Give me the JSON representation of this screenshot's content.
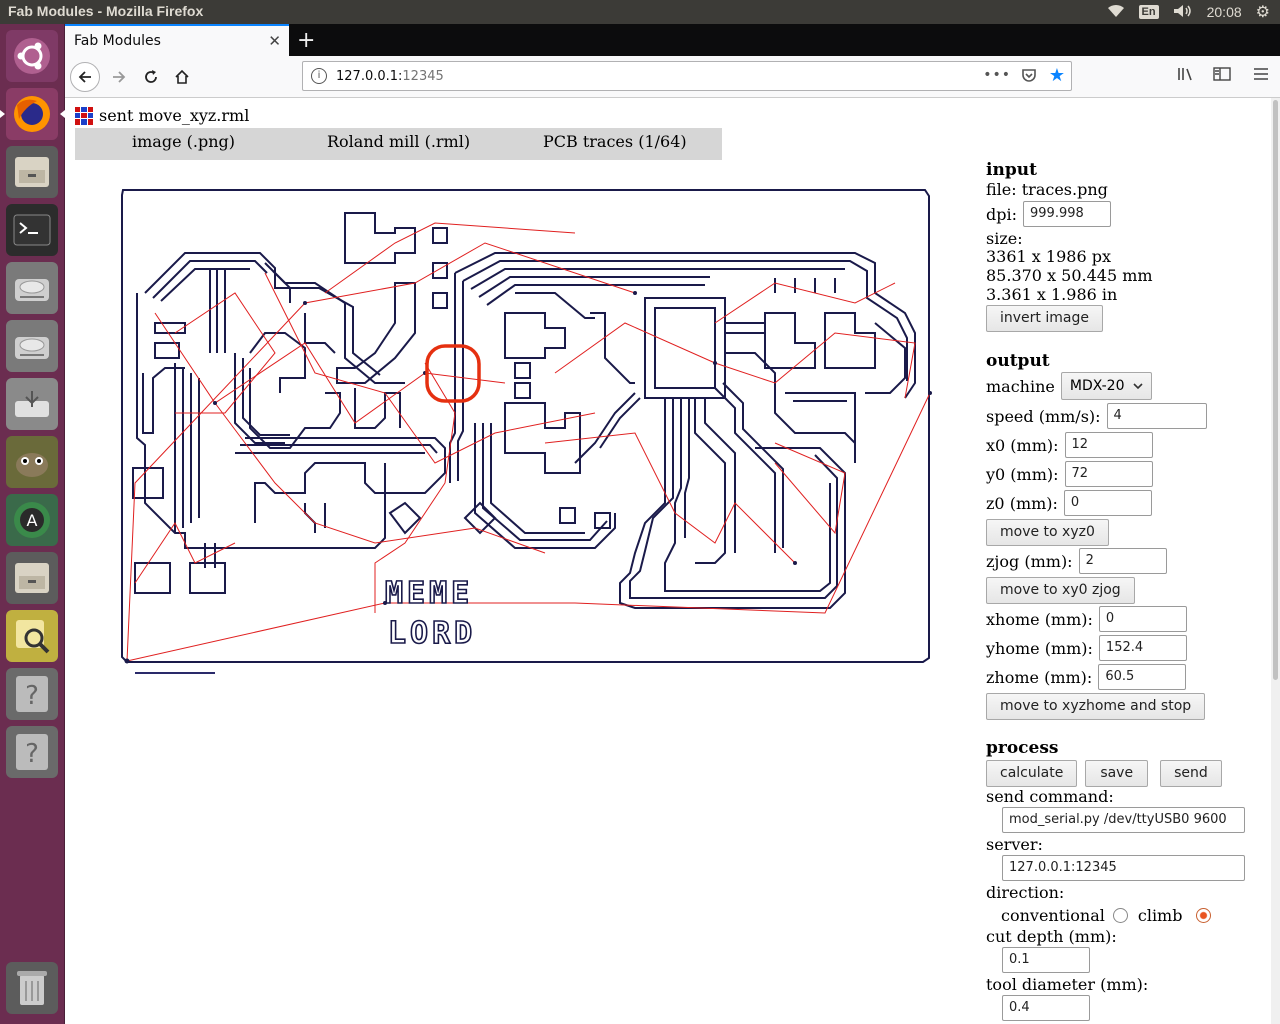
{
  "topbar": {
    "window_title": "Fab Modules - Mozilla Firefox",
    "lang": "En",
    "clock": "20:08"
  },
  "launcher": {
    "items": [
      "ubuntu-icon",
      "firefox-icon",
      "files-icon",
      "terminal-icon",
      "disk-icon",
      "disk-icon",
      "usb-icon",
      "gimp-icon",
      "software-updater-icon",
      "files-icon",
      "image-viewer-icon",
      "unknown-app-icon",
      "unknown-app-icon",
      "trash-icon"
    ]
  },
  "browser": {
    "tab_title": "Fab Modules",
    "url_host": "127.0.0.1:",
    "url_port": "12345",
    "url_menu": "•••"
  },
  "page": {
    "status": "sent move_xyz.rml",
    "menu": [
      "image (.png)",
      "Roland mill (.rml)",
      "PCB traces (1/64)"
    ],
    "board_text": [
      "MEME",
      "LORD"
    ],
    "input": {
      "heading": "input",
      "file": "file: traces.png",
      "dpi_label": "dpi:",
      "dpi": "999.998",
      "size_label": "size:",
      "size_px": "3361 x 1986 px",
      "size_mm": "85.370 x 50.445 mm",
      "size_in": "3.361 x 1.986 in",
      "invert_button": "invert image"
    },
    "output": {
      "heading": "output",
      "machine_label": "machine",
      "machine": "MDX-20",
      "speed_label": "speed (mm/s):",
      "speed": "4",
      "x0_label": "x0 (mm):",
      "x0": "12",
      "y0_label": "y0 (mm):",
      "y0": "72",
      "z0_label": "z0 (mm):",
      "z0": "0",
      "move_xyz0_button": "move to xyz0",
      "zjog_label": "zjog (mm):",
      "zjog": "2",
      "move_xy0_zjog_button": "move to xy0 zjog",
      "xhome_label": "xhome (mm):",
      "xhome": "0",
      "yhome_label": "yhome (mm):",
      "yhome": "152.4",
      "zhome_label": "zhome (mm):",
      "zhome": "60.5",
      "move_home_button": "move to xyzhome and stop"
    },
    "process": {
      "heading": "process",
      "calculate_button": "calculate",
      "save_button": "save",
      "send_button": "send",
      "send_command_label": "send command:",
      "send_command": "mod_serial.py /dev/ttyUSB0 9600",
      "server_label": "server:",
      "server": "127.0.0.1:12345",
      "direction_label": "direction:",
      "conventional_label": "conventional",
      "climb_label": "climb",
      "direction_selected": "climb",
      "cut_depth_label": "cut depth (mm):",
      "cut_depth": "0.1",
      "tool_diameter_label": "tool diameter (mm):",
      "tool_diameter": "0.4"
    }
  },
  "colors": {
    "launcher": "#6b2d50",
    "trace": "#1a1a4a",
    "path": "#e02020",
    "highlight": "#e53010",
    "accent": "#0a84ff"
  }
}
